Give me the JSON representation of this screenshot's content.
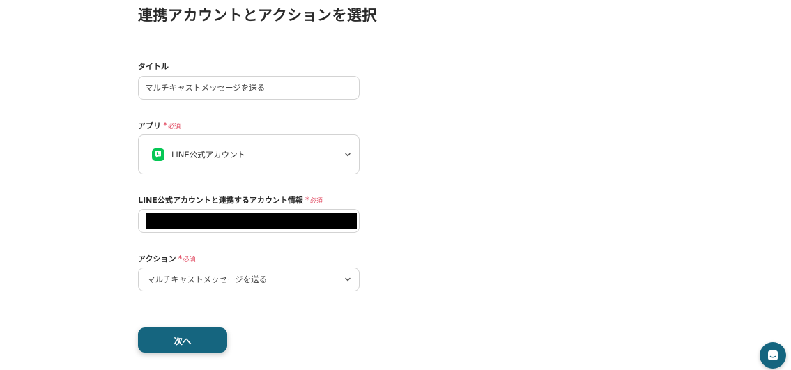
{
  "page": {
    "title": "連携アカウントとアクションを選択"
  },
  "title_field": {
    "label": "タイトル",
    "value": "マルチキャストメッセージを送る"
  },
  "app_field": {
    "label": "アプリ",
    "required_mark": "*",
    "required_text": "必須",
    "value": "LINE公式アカウント",
    "icon": "line-app-icon",
    "icon_color": "#06c755"
  },
  "account_field": {
    "label": "LINE公式アカウントと連携するアカウント情報",
    "required_mark": "*",
    "required_text": "必須"
  },
  "action_field": {
    "label": "アクション",
    "required_mark": "*",
    "required_text": "必須",
    "value": "マルチキャストメッセージを送る"
  },
  "next_button": {
    "label": "次へ",
    "color": "#15657f"
  },
  "chat_launcher": {
    "icon": "chat-icon",
    "color": "#15657f"
  },
  "colors": {
    "required": "#e0435b",
    "border": "#d3d3d3"
  }
}
